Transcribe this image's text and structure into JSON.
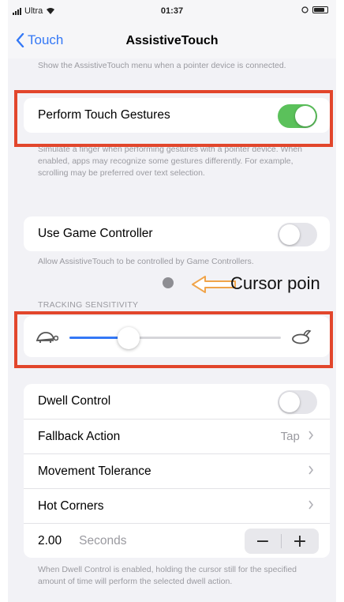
{
  "status": {
    "carrier": "Ultra",
    "time": "01:37"
  },
  "nav": {
    "back_label": "Touch",
    "title": "AssistiveTouch"
  },
  "pointer_footer": "Show the AssistiveTouch menu when a pointer device is connected.",
  "perform_touch": {
    "label": "Perform Touch Gestures",
    "on": true
  },
  "perform_touch_footer": "Simulate a finger when performing gestures with a pointer device. When enabled, apps may recognize some gestures differently. For example, scrolling may be preferred over text selection.",
  "game_controller": {
    "label": "Use Game Controller",
    "on": false
  },
  "game_controller_footer": "Allow AssistiveTouch to be controlled by Game Controllers.",
  "annotation": {
    "text": "Cursor poin"
  },
  "tracking": {
    "header": "TRACKING SENSITIVITY",
    "level": 0.28
  },
  "dwell": {
    "dwell_control": {
      "label": "Dwell Control",
      "on": false
    },
    "fallback_action": {
      "label": "Fallback Action",
      "value": "Tap"
    },
    "movement_tolerance": {
      "label": "Movement Tolerance"
    },
    "hot_corners": {
      "label": "Hot Corners"
    },
    "time": {
      "value": "2.00",
      "unit": "Seconds",
      "minus": "−",
      "plus": "+"
    }
  },
  "dwell_footer": "When Dwell Control is enabled, holding the cursor still for the specified amount of time will perform the selected dwell action.",
  "colors": {
    "accent": "#3478f6",
    "toggle_on": "#5bc15b",
    "annotation_box": "#e2462c",
    "annotation_arrow": "#f0a44a"
  }
}
